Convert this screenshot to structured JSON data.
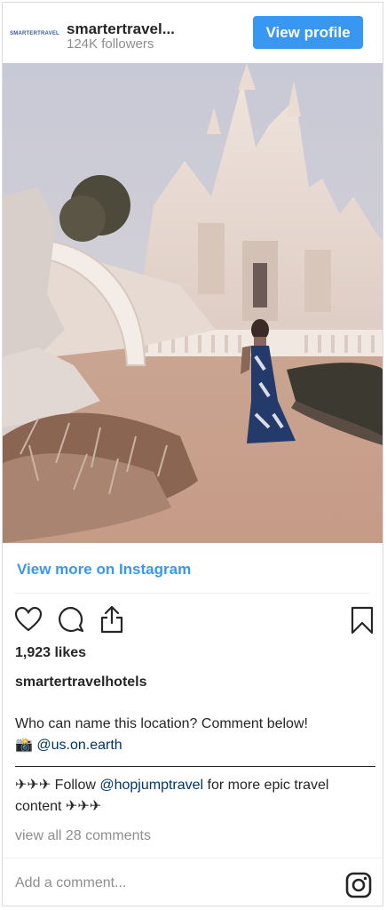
{
  "header": {
    "avatar_text": "SMARTERTRAVEL",
    "account_name": "smartertravel...",
    "followers": "124K followers",
    "view_profile_label": "View profile"
  },
  "post": {
    "view_more_label": "View more on Instagram",
    "likes": "1,923 likes",
    "username": "smartertravelhotels",
    "caption_line1": "Who can name this location? Comment below!",
    "camera_emoji": "📸",
    "credit_handle": "@us.on.earth",
    "planes_before": "✈✈✈ Follow ",
    "follow_handle": "@hopjumptravel",
    "follow_text": " for more epic travel content ✈✈✈",
    "view_comments": "view all 28 comments",
    "add_comment_placeholder": "Add a comment..."
  },
  "icons": [
    "heart-icon",
    "comment-icon",
    "share-icon",
    "bookmark-icon",
    "instagram-icon"
  ],
  "colors": {
    "accent": "#3897f0",
    "muted": "#8e8e8e",
    "text": "#262626"
  }
}
